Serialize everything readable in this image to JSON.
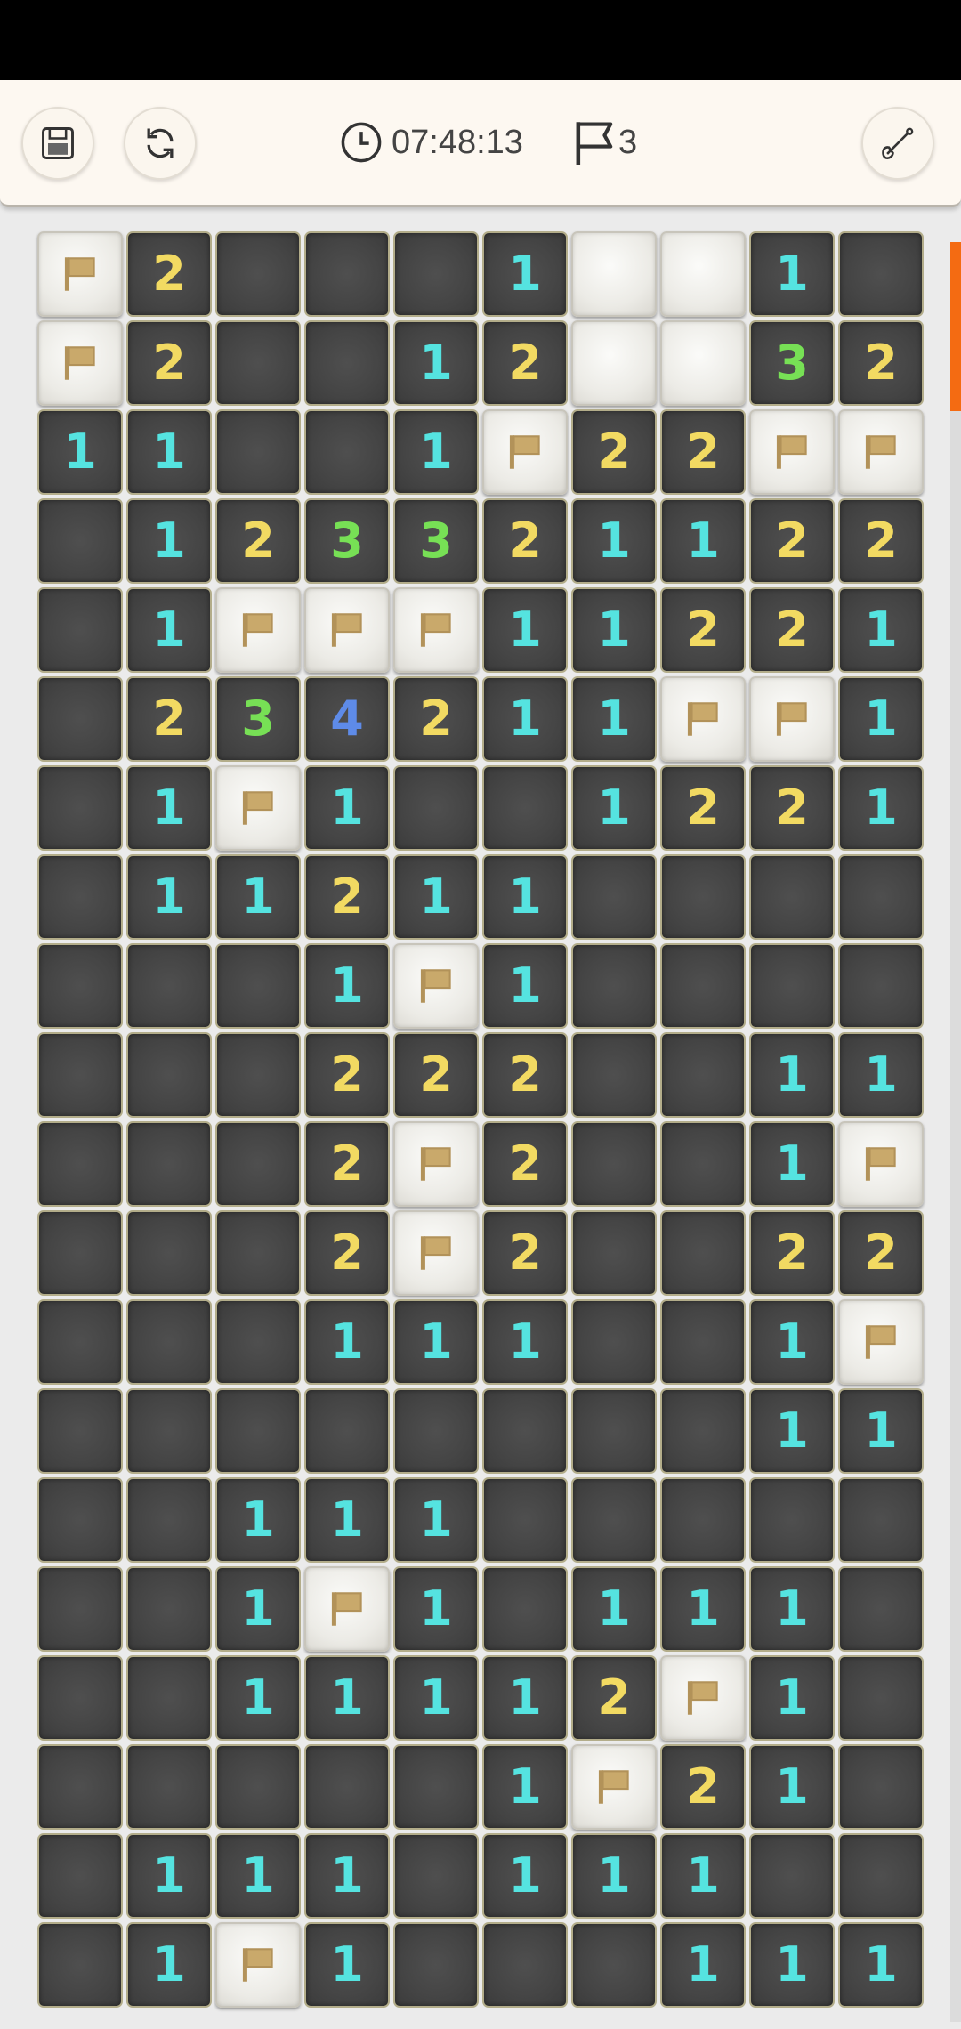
{
  "toolbar": {
    "save_icon": "save-icon",
    "restart_icon": "restart-icon",
    "timer": "07:48:13",
    "flag_count": "3",
    "tool_icon": "shovel-icon"
  },
  "colors": {
    "number_1": "#55e3e0",
    "number_2": "#f2da62",
    "number_3": "#77e055",
    "number_4": "#5e8be8",
    "revealed_cell": "#454545",
    "hidden_cell": "#ecebe6",
    "flag": "#c9a96b",
    "scroll_thumb": "#f46b12"
  },
  "board": {
    "columns": 10,
    "rows": 20,
    "legend": {
      "F": "flagged",
      "H": "hidden",
      "0": "revealed-empty",
      "1-8": "revealed-number"
    },
    "grid": [
      [
        "F",
        "2",
        "0",
        "0",
        "0",
        "1",
        "H",
        "H",
        "1",
        "0"
      ],
      [
        "F",
        "2",
        "0",
        "0",
        "1",
        "2",
        "H",
        "H",
        "3",
        "2"
      ],
      [
        "1",
        "1",
        "0",
        "0",
        "1",
        "F",
        "2",
        "2",
        "F",
        "F"
      ],
      [
        "0",
        "1",
        "2",
        "3",
        "3",
        "2",
        "1",
        "1",
        "2",
        "2"
      ],
      [
        "0",
        "1",
        "F",
        "F",
        "F",
        "1",
        "1",
        "2",
        "2",
        "1"
      ],
      [
        "0",
        "2",
        "3",
        "4",
        "2",
        "1",
        "1",
        "F",
        "F",
        "1"
      ],
      [
        "0",
        "1",
        "F",
        "1",
        "0",
        "0",
        "1",
        "2",
        "2",
        "1"
      ],
      [
        "0",
        "1",
        "1",
        "2",
        "1",
        "1",
        "0",
        "0",
        "0",
        "0"
      ],
      [
        "0",
        "0",
        "0",
        "1",
        "F",
        "1",
        "0",
        "0",
        "0",
        "0"
      ],
      [
        "0",
        "0",
        "0",
        "2",
        "2",
        "2",
        "0",
        "0",
        "1",
        "1"
      ],
      [
        "0",
        "0",
        "0",
        "2",
        "F",
        "2",
        "0",
        "0",
        "1",
        "F"
      ],
      [
        "0",
        "0",
        "0",
        "2",
        "F",
        "2",
        "0",
        "0",
        "2",
        "2"
      ],
      [
        "0",
        "0",
        "0",
        "1",
        "1",
        "1",
        "0",
        "0",
        "1",
        "F"
      ],
      [
        "0",
        "0",
        "0",
        "0",
        "0",
        "0",
        "0",
        "0",
        "1",
        "1"
      ],
      [
        "0",
        "0",
        "1",
        "1",
        "1",
        "0",
        "0",
        "0",
        "0",
        "0"
      ],
      [
        "0",
        "0",
        "1",
        "F",
        "1",
        "0",
        "1",
        "1",
        "1",
        "0"
      ],
      [
        "0",
        "0",
        "1",
        "1",
        "1",
        "1",
        "2",
        "F",
        "1",
        "0"
      ],
      [
        "0",
        "0",
        "0",
        "0",
        "0",
        "1",
        "F",
        "2",
        "1",
        "0"
      ],
      [
        "0",
        "1",
        "1",
        "1",
        "0",
        "1",
        "1",
        "1",
        "0",
        "0"
      ],
      [
        "0",
        "1",
        "F",
        "1",
        "0",
        "0",
        "0",
        "1",
        "1",
        "1"
      ]
    ]
  }
}
